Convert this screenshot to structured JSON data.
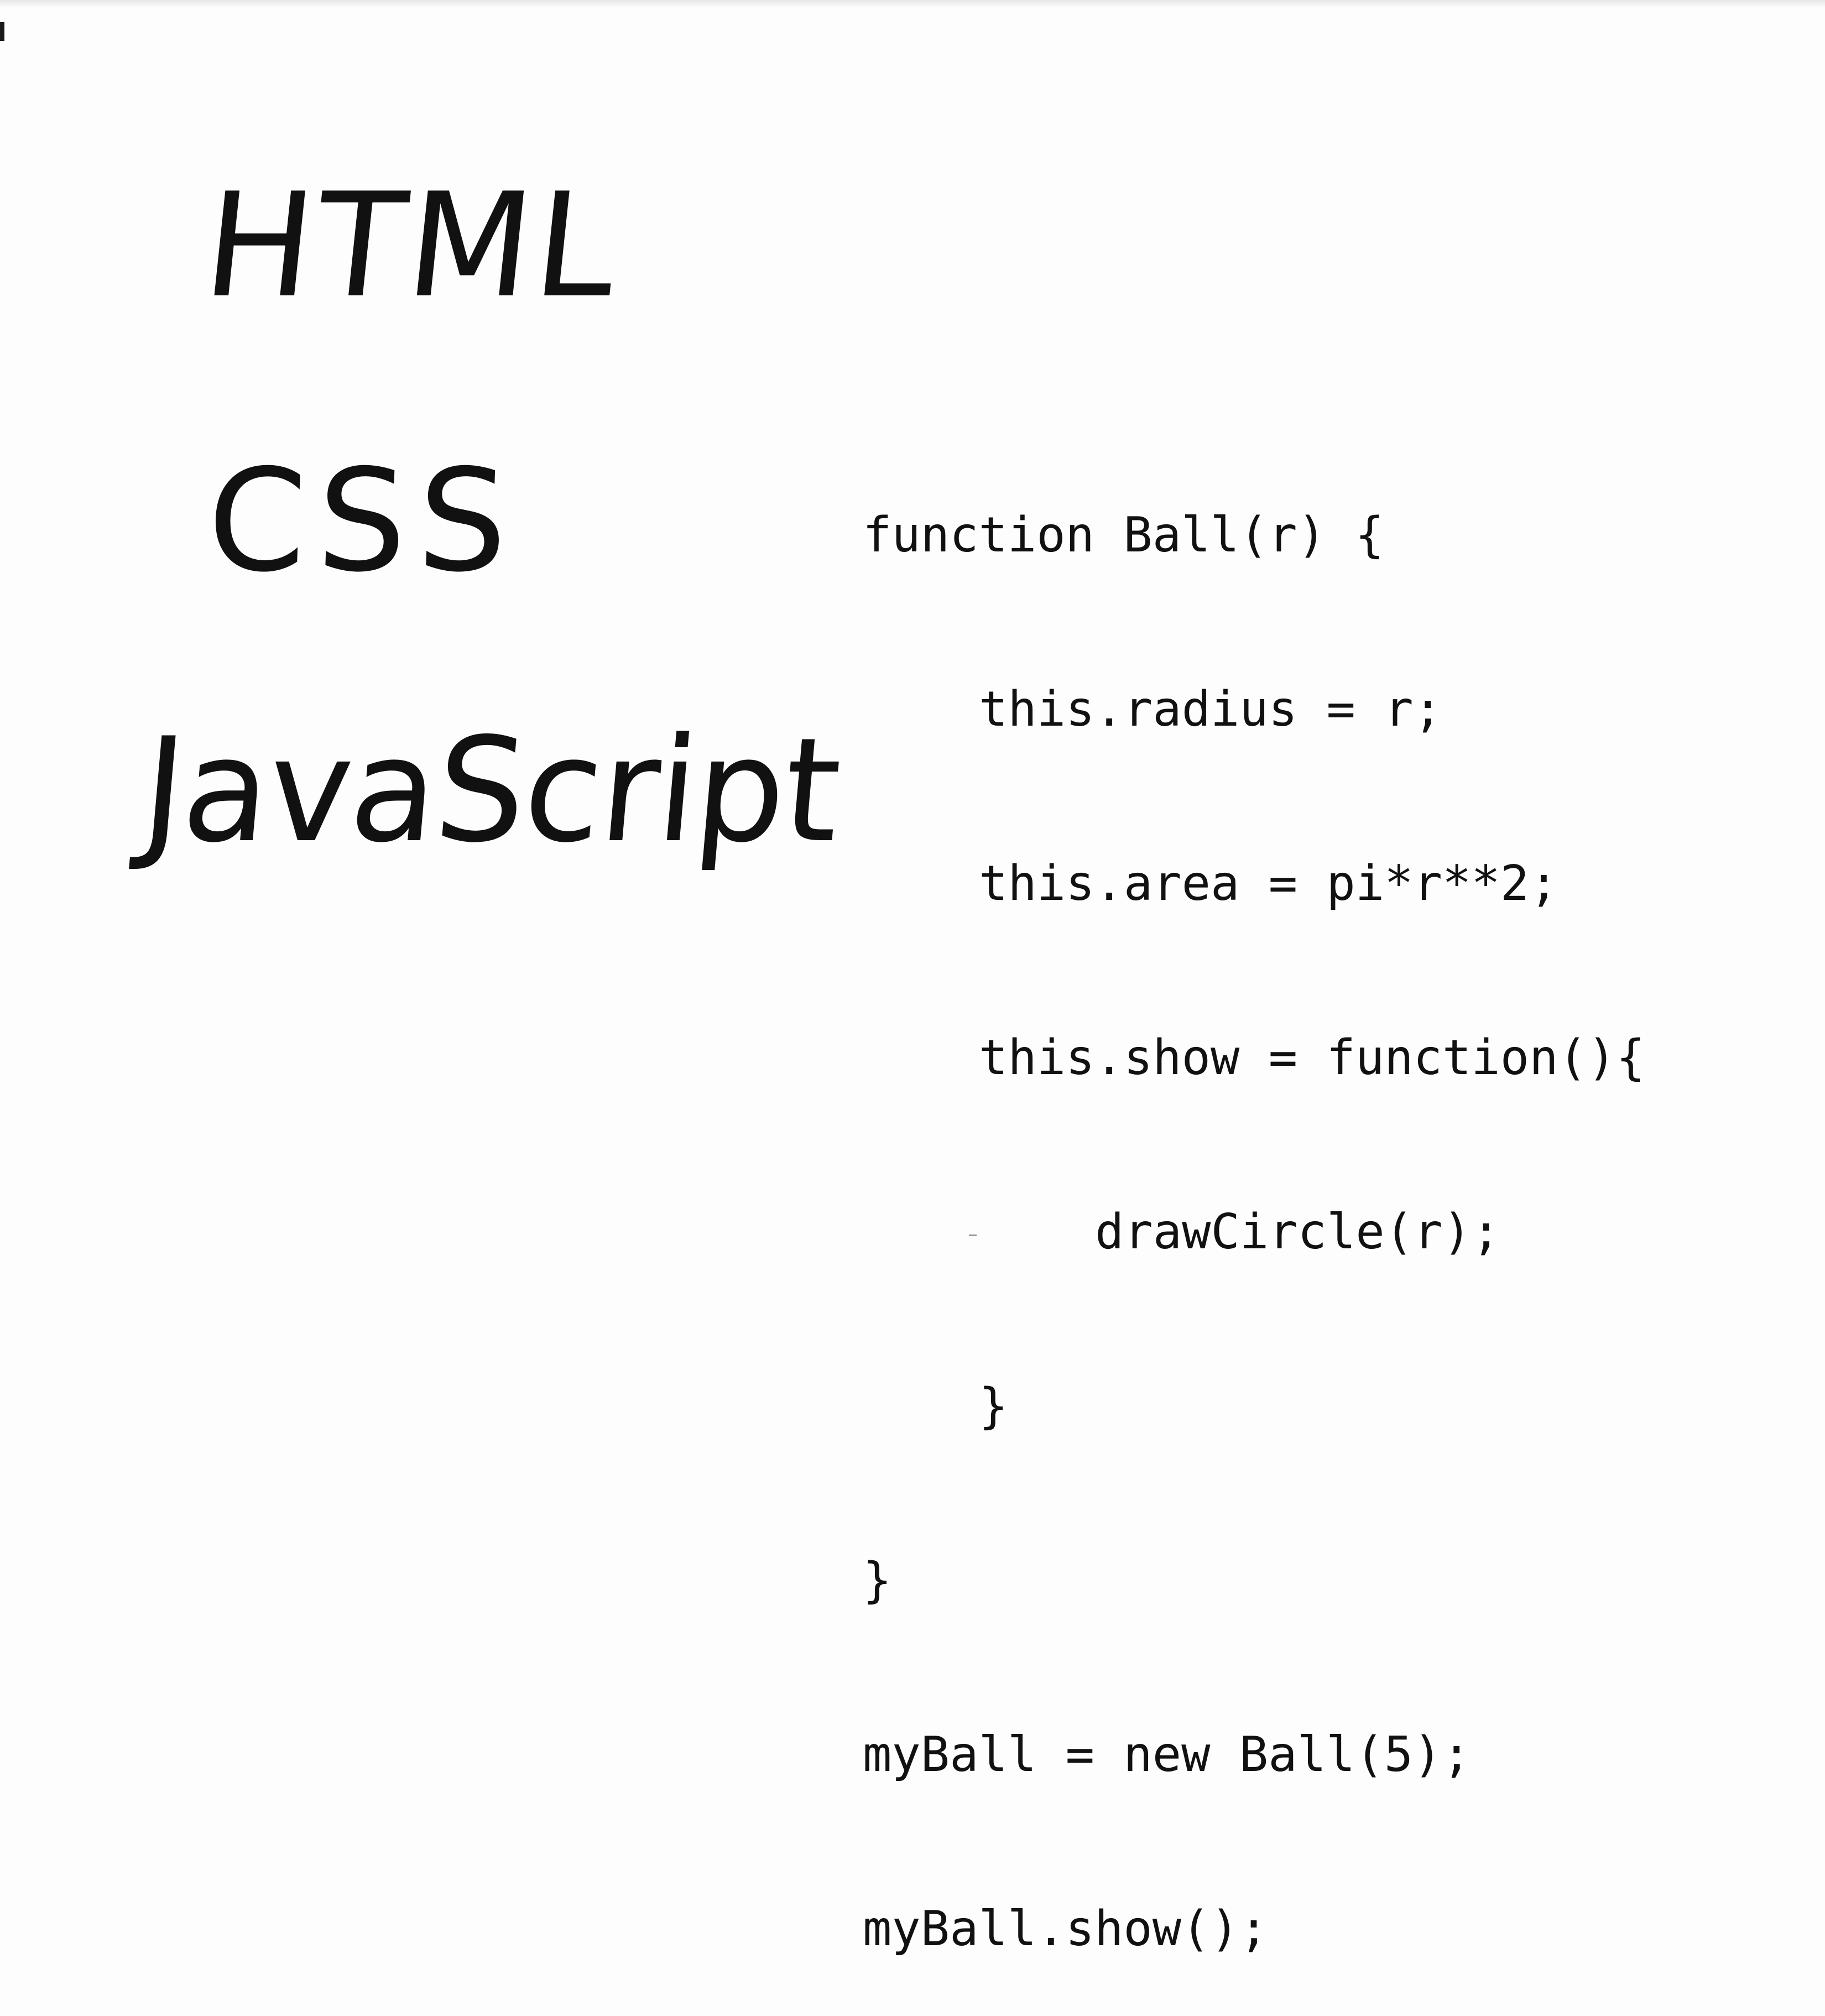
{
  "handwritten": {
    "html": "HTML",
    "css": "CSS",
    "javascript": "JavaScript"
  },
  "code": {
    "lines": [
      "function Ball(r) {",
      "this.radius = r;",
      "this.area = pi*r**2;",
      "this.show = function(){",
      "drawCircle(r);",
      "}",
      "}",
      "myBall = new Ball(5);",
      "myBall.show();"
    ]
  }
}
